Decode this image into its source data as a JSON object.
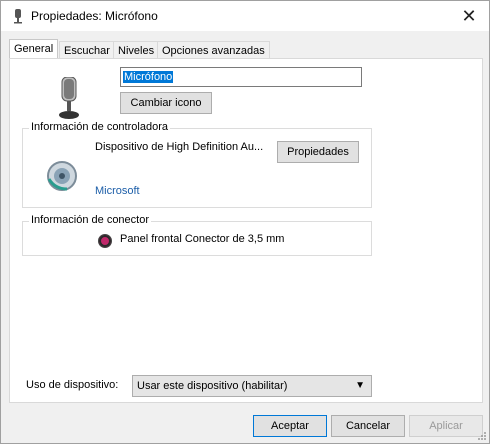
{
  "window": {
    "title": "Propiedades: Micrófono"
  },
  "tabs": [
    {
      "label": "General"
    },
    {
      "label": "Escuchar"
    },
    {
      "label": "Niveles"
    },
    {
      "label": "Opciones avanzadas"
    }
  ],
  "general": {
    "device_name": "Micrófono",
    "change_icon_label": "Cambiar icono",
    "controller_group": {
      "legend": "Información de controladora",
      "device": "Dispositivo de High Definition Au...",
      "manufacturer": "Microsoft",
      "properties_label": "Propiedades"
    },
    "connector_group": {
      "legend": "Información de conector",
      "jack": "Panel frontal Conector de 3,5 mm",
      "jack_color": "#c0286a"
    },
    "usage": {
      "label": "Uso de dispositivo:",
      "selected": "Usar este dispositivo (habilitar)"
    }
  },
  "footer": {
    "ok_label": "Aceptar",
    "cancel_label": "Cancelar",
    "apply_label": "Aplicar"
  },
  "colors": {
    "accent": "#0078d7",
    "link": "#1c5ea8"
  }
}
